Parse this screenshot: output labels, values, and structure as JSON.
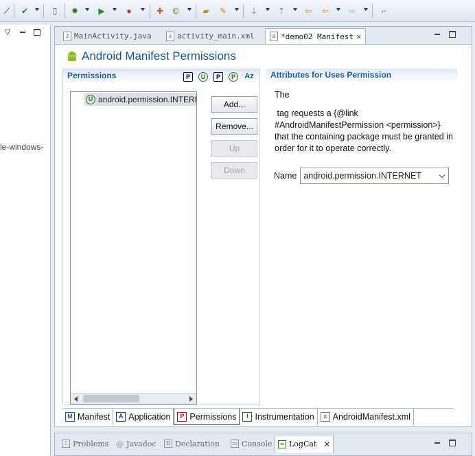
{
  "editor": {
    "tabs": [
      {
        "label": "MainActivity.java",
        "active": false
      },
      {
        "label": "activity_main.xml",
        "active": false
      },
      {
        "label": "*demo02 Manifest",
        "active": true
      }
    ]
  },
  "page": {
    "title": "Android Manifest Permissions"
  },
  "left_view": {
    "visible_text": "le-windows-"
  },
  "permissions_section": {
    "header": "Permissions",
    "filter_buttons": [
      "P",
      "U",
      "P",
      "P",
      "Az"
    ],
    "items": [
      "android.permission.INTERNET"
    ],
    "buttons": [
      {
        "label": "Add...",
        "enabled": true
      },
      {
        "label": "Remove...",
        "enabled": true
      },
      {
        "label": "Up",
        "enabled": false
      },
      {
        "label": "Down",
        "enabled": false
      }
    ]
  },
  "attributes_section": {
    "header": "Attributes for Uses Permission",
    "description_line1": "The",
    "description_line2": " tag requests a {@link #AndroidManifestPermission <permission>} that the containing package must be granted in order for it to operate correctly.",
    "name_label": "Name",
    "name_value": "android.permission.INTERNET"
  },
  "page_tabs": [
    {
      "label": "Manifest",
      "icon": "M",
      "active": false
    },
    {
      "label": "Application",
      "icon": "A",
      "active": false
    },
    {
      "label": "Permissions",
      "icon": "P",
      "active": true
    },
    {
      "label": "Instrumentation",
      "icon": "I",
      "active": false
    },
    {
      "label": "AndroidManifest.xml",
      "icon": "x",
      "active": false
    }
  ],
  "bottom_tabs": [
    {
      "label": "Problems",
      "active": false
    },
    {
      "label": "Javadoc",
      "active": false
    },
    {
      "label": "Declaration",
      "active": false
    },
    {
      "label": "Console",
      "active": false
    },
    {
      "label": "LogCat",
      "active": true
    }
  ],
  "colors": {
    "accent_title": "#15559a",
    "section_header": "#1f5aa6",
    "android_green": "#8cbf26"
  }
}
